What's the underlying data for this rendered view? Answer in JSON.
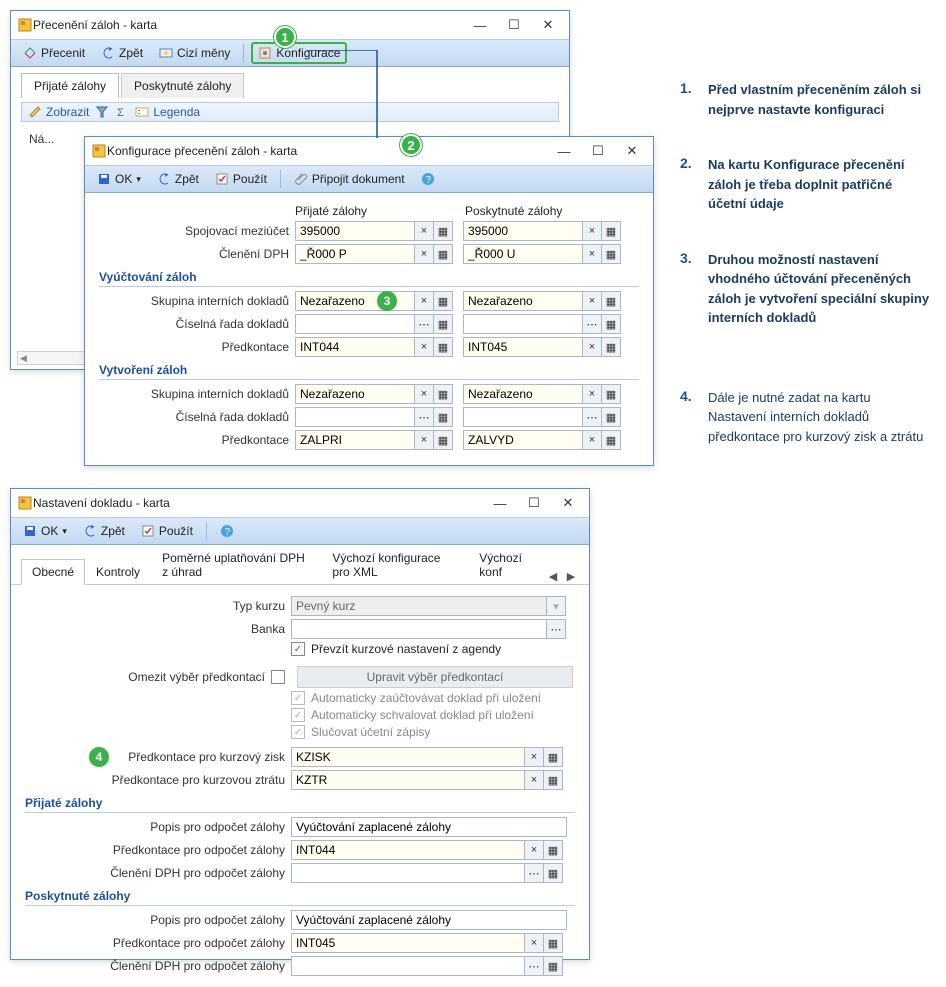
{
  "win1": {
    "title": "Přecenění záloh - karta",
    "toolbar": {
      "btn1": "Přecenit",
      "btn2": "Zpět",
      "btn3": "Cizí měny",
      "btn4": "Konfigurace"
    },
    "tabs": [
      "Přijaté zálohy",
      "Poskytnuté zálohy"
    ],
    "sub": {
      "zobrazit": "Zobrazit",
      "legenda": "Legenda"
    },
    "grid_headers": "Ná..."
  },
  "win2": {
    "title": "Konfigurace přecenění záloh - karta",
    "toolbar": {
      "ok": "OK",
      "zpet": "Zpět",
      "pouzit": "Použít",
      "pripojit": "Připojit dokument"
    },
    "col1": "Přijaté zálohy",
    "col2": "Poskytnuté zálohy",
    "labels": {
      "spojovaci": "Spojovací meziúčet",
      "cleneni": "Členění DPH",
      "sec1": "Vyúčtování záloh",
      "skupina": "Skupina interních dokladů",
      "rada": "Číselná řada dokladů",
      "predkontace": "Předkontace",
      "sec2": "Vytvoření záloh"
    },
    "vals": {
      "spojovaci_p": "395000",
      "spojovaci_k": "395000",
      "cleneni_p": "_Ř000 P",
      "cleneni_k": "_Ř000 U",
      "skup1_p": "Nezařazeno",
      "skup1_k": "Nezařazeno",
      "rada1_p": "",
      "rada1_k": "",
      "pred1_p": "INT044",
      "pred1_k": "INT045",
      "skup2_p": "Nezařazeno",
      "skup2_k": "Nezařazeno",
      "rada2_p": "",
      "rada2_k": "",
      "pred2_p": "ZALPRI",
      "pred2_k": "ZALVYD"
    }
  },
  "win3": {
    "title": "Nastavení dokladu - karta",
    "toolbar": {
      "ok": "OK",
      "zpet": "Zpět",
      "pouzit": "Použít"
    },
    "tabs": [
      "Obecné",
      "Kontroly",
      "Poměrné uplatňování DPH z úhrad",
      "Výchozí konfigurace pro XML",
      "Výchozí konf"
    ],
    "labels": {
      "typ": "Typ kurzu",
      "banka": "Banka",
      "prevzit": "Převzít kurzové nastavení z agendy",
      "omezit": "Omezit výběr předkontací",
      "upravit": "Upravit výběr předkontací",
      "auto1": "Automaticky zaúčtovávat doklad při uložení",
      "auto2": "Automaticky schvalovat doklad při uložení",
      "auto3": "Slučovat účetní zápisy",
      "pred_zisk": "Předkontace pro kurzový zisk",
      "pred_ztrata": "Předkontace pro kurzovou ztrátu",
      "sec_prij": "Přijaté zálohy",
      "popis": "Popis pro odpočet zálohy",
      "pred_odp": "Předkontace pro odpočet zálohy",
      "clen_odp": "Členění DPH pro odpočet zálohy",
      "sec_posk": "Poskytnuté zálohy"
    },
    "vals": {
      "typ": "Pevný kurz",
      "banka": "",
      "kzisk": "KZISK",
      "kztr": "KZTR",
      "popis_p": "Vyúčtování zaplacené zálohy",
      "pred_p": "INT044",
      "clen_p": "",
      "popis_k": "Vyúčtování zaplacené zálohy",
      "pred_k": "INT045",
      "clen_k": ""
    }
  },
  "notes": [
    {
      "n": "1.",
      "t": "Před vlastním přeceněním záloh si nejprve nastavte konfiguraci"
    },
    {
      "n": "2.",
      "t": "Na kartu Konfigurace přecenění záloh je třeba doplnit patřičné účetní údaje"
    },
    {
      "n": "3.",
      "t": "Druhou možností nastavení vhodného účtování přeceněných záloh je vytvoření speciální skupiny interních dokladů"
    },
    {
      "n": "4.",
      "t": "Dále je nutné zadat na kartu Nastavení interních dokladů předkontace pro kurzový zisk a ztrátu"
    }
  ]
}
